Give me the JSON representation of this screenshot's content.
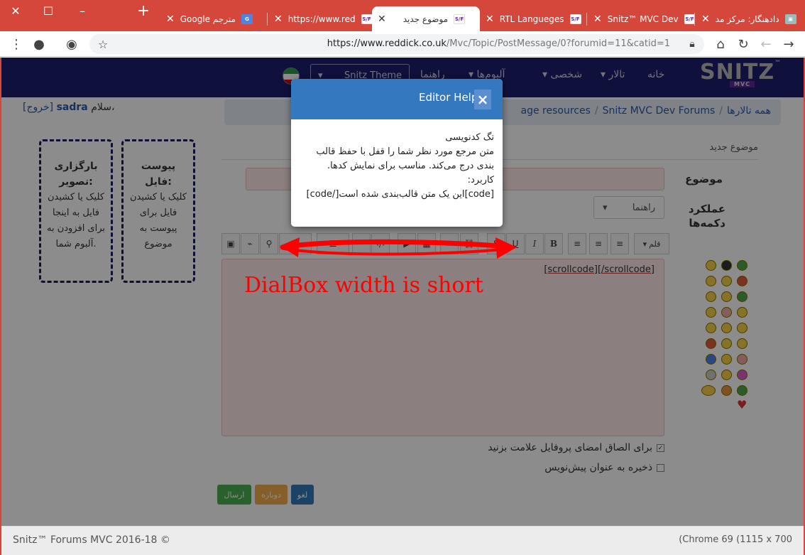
{
  "browser": {
    "window_buttons": {
      "close": "✕",
      "maximize": "☐",
      "minimize": "–"
    },
    "new_tab": "+",
    "tabs": [
      {
        "title": "دادهنگار: مرکز مد",
        "icon": "site-icon"
      },
      {
        "title": "Snitz™ MVC Dev",
        "icon": "snitz-icon"
      },
      {
        "title": "RTL Langueges",
        "icon": "snitz-icon"
      },
      {
        "title": "موضوع جدید",
        "icon": "snitz-icon",
        "active": true
      },
      {
        "title": "https://www.red",
        "icon": "snitz-icon"
      },
      {
        "title": "Google مترجم",
        "icon": "google-translate-icon"
      }
    ],
    "url_host": "https://www.reddick.co.uk",
    "url_path": "/Mvc/Topic/PostMessage/0?forumid=11&catid=1"
  },
  "nav": {
    "home": "خانه",
    "forum": "تالار",
    "personal": "شخصی",
    "albums": "آلبوم‌ها",
    "guide": "راهنما",
    "theme": "Snitz Theme",
    "logo": "SNITZ",
    "logo_tm": "™",
    "logo_mvc": "MVC"
  },
  "greeting": {
    "hello": "سلام،",
    "user": "sadra",
    "logout": "[خروج]"
  },
  "breadcrumb": {
    "all_forums": "همه تالارها",
    "dev_forums": "Snitz MVC Dev Forums",
    "resources": "age resources"
  },
  "page": {
    "subtitle": "موضوع جدید"
  },
  "form": {
    "subject_label": "موضوع",
    "buttons_label": "عملکرد دکمه‌ها",
    "guide_select": "راهنما",
    "font_button": "قلم",
    "editor_content": "[scrollcode][/scrollcode]",
    "signature_check": "برای الصاق امضای پروفایل علامت بزنید",
    "draft_check": "ذخیره به عنوان پیش‌نویس",
    "cancel": "لغو",
    "reset": "دوباره",
    "send": "ارسال"
  },
  "dropzones": {
    "attach_title": "پیوست فایل:",
    "attach_text": "کلیک یا کشیدن فایل برای پیوست به موضوع",
    "image_title": "بارگزاری تصویر:",
    "image_text": "کلیک یا کشیدن فایل به اینجا برای افزودن به آلبوم شما."
  },
  "annotation": "DialBox width is short",
  "dialog": {
    "title": "Editor Help",
    "close": "×",
    "heading": "تگ کدنویسی",
    "desc": "متن مرجع مورد نظر شما را قفل با حفظ قالب بندی درج می‌کند. مناسب برای نمایش کدها.",
    "usage": "کاربرد:",
    "example": "[code]این یک متن قالب‌بندی شده است[/code]"
  },
  "footer": {
    "left": "Snitz™ Forums MVC 2016-18 ©",
    "right": "(Chrome 69 (1115 x 700"
  }
}
